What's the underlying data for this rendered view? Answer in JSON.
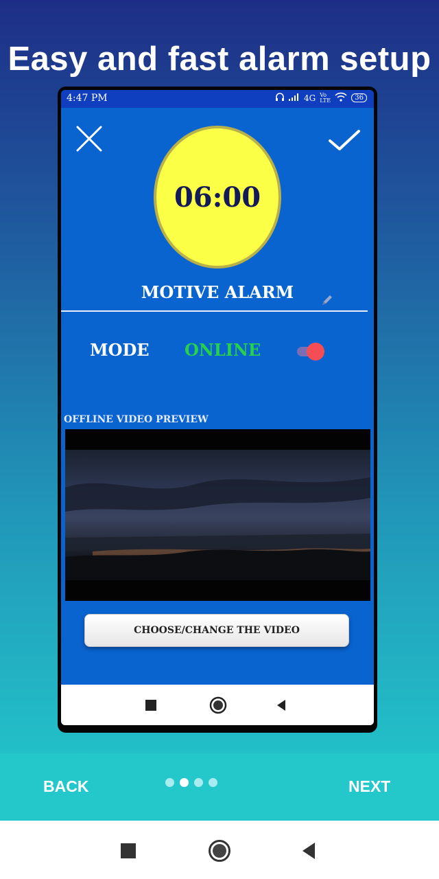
{
  "headline": "Easy and fast alarm setup",
  "status_bar": {
    "time": "4:47 PM",
    "network": "4G",
    "volte": "Vo LTE",
    "battery": "36"
  },
  "alarm": {
    "time": "06:00",
    "name": "MOTIVE ALARM"
  },
  "mode": {
    "label": "MODE",
    "value": "ONLINE",
    "toggle_on": true
  },
  "preview": {
    "label": "OFFLINE VIDEO PREVIEW"
  },
  "choose_video_button": "CHOOSE/CHANGE THE VIDEO",
  "pager": {
    "back": "BACK",
    "next": "NEXT",
    "total_pages": 4,
    "active_page": 2
  },
  "colors": {
    "screen_bg": "#0a64d0",
    "clock_fill": "#fbff46",
    "online_green": "#27d14a",
    "toggle_thumb": "#f44d56",
    "bottom_bar": "#24c8cb"
  }
}
